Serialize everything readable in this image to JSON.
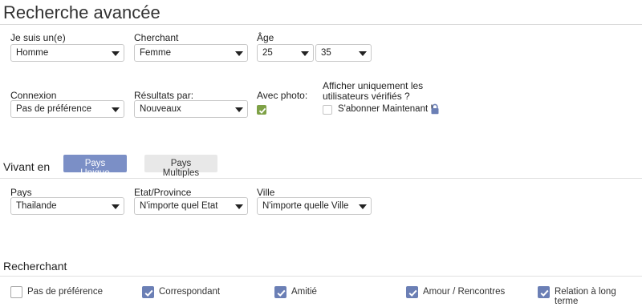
{
  "page": {
    "title": "Recherche avancée"
  },
  "filters": {
    "gender": {
      "label": "Je suis un(e)",
      "value": "Homme"
    },
    "seeking": {
      "label": "Cherchant",
      "value": "Femme"
    },
    "age": {
      "label": "Âge",
      "min": "25",
      "max": "35"
    },
    "connection": {
      "label": "Connexion",
      "value": "Pas de préférence"
    },
    "results": {
      "label": "Résultats par:",
      "value": "Nouveaux"
    },
    "photo": {
      "label": "Avec photo:",
      "checked": true
    },
    "verified": {
      "label_line1": "Afficher uniquement les",
      "label_line2": "utilisateurs vérifiés ?",
      "subscribe": "S'abonner Maintenant !",
      "checked": false
    }
  },
  "location": {
    "title": "Vivant en",
    "single_button": "Pays Unique",
    "multi_button": "Pays Multiples",
    "country": {
      "label": "Pays",
      "value": "Thailande"
    },
    "state": {
      "label": "Etat/Province",
      "value": "N'importe quel Etat"
    },
    "city": {
      "label": "Ville",
      "value": "N'importe quelle Ville"
    }
  },
  "seeking_section": {
    "title": "Recherchant",
    "options": [
      {
        "label": "Pas de préférence",
        "checked": false
      },
      {
        "label": "Correspondant",
        "checked": true
      },
      {
        "label": "Amitié",
        "checked": true
      },
      {
        "label": "Amour / Rencontres",
        "checked": true
      },
      {
        "label": "Relation à long terme",
        "checked": true
      }
    ]
  },
  "colors": {
    "accent": "#7b8fc6",
    "check_green": "#7ea146",
    "check_blue": "#6b7fb5"
  }
}
